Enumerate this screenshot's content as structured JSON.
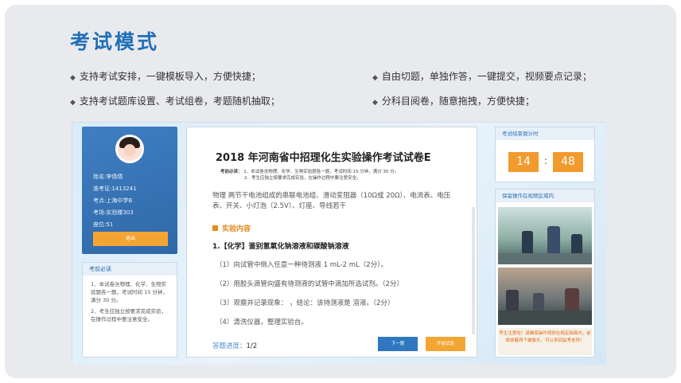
{
  "heading": "考试模式",
  "features": [
    "支持考试安排，一键模板导入，方便快捷；",
    "自由切题，单独作答，一键提交，视频要点记录；",
    "支持考试题库设置、考试组卷，考题随机抽取；",
    "分科目阅卷，随意拖拽，方便快捷；"
  ],
  "screenshot": {
    "profile": {
      "name": "姓名:李倩倩",
      "ticket": "准考证:1413241",
      "site": "考点:上海中学B",
      "room": "考场:实验楼303",
      "seat": "座位:51",
      "logout": "退出"
    },
    "notice": {
      "title": "考前必读",
      "items": [
        "1．本试卷含物理、化学、生物实验题各一题，考试时间 15 分钟，满分 30 分。",
        "2．考生应独立按要求完成实验，在操作过程中要注意安全。"
      ]
    },
    "paper": {
      "title": "2018 年河南省中招理化生实验操作考试试卷E",
      "req_label": "考前必读：",
      "req_lines": [
        "1．本试卷含物理、化学、生物实验题各一题，考试时间 15 分钟，满分 30 分。",
        "2．考生应独立按要求完成实验，在操作过程中要注意安全。"
      ],
      "equipment": "物理 两节干电池组成的串联电池组、滑动变阻器（10Ω或 20Ω）、电流表、电压表、开关、小灯泡（2.5V）、灯座、导线若干",
      "section": "实验内容",
      "question": "1.【化学】鉴别氢氧化钠溶液和碳酸钠溶液",
      "steps": [
        "（1）向试管中倒入任意一种待测液 1 mL-2 mL（2分）。",
        "（2）用胶头滴管向盛有待测液的试管中滴加所选试剂。（2分）",
        "（3）观察并记录现象：        ，结论：该待测液是        溶液。（2分）",
        "（4）清洗仪器，整理实验台。"
      ],
      "progress_label": "答题进度：",
      "progress_value": "1/2",
      "next": "下一题",
      "start": "开始试验"
    },
    "timer": {
      "title": "考试结束倒计时",
      "minutes": "14",
      "seconds": "48"
    },
    "video": {
      "title": "保留操作在视频区域内",
      "note": "考生注意啦！请确保操作视频在规定画面内，前面放着两个摄像头，可以来回监考老师！"
    }
  }
}
